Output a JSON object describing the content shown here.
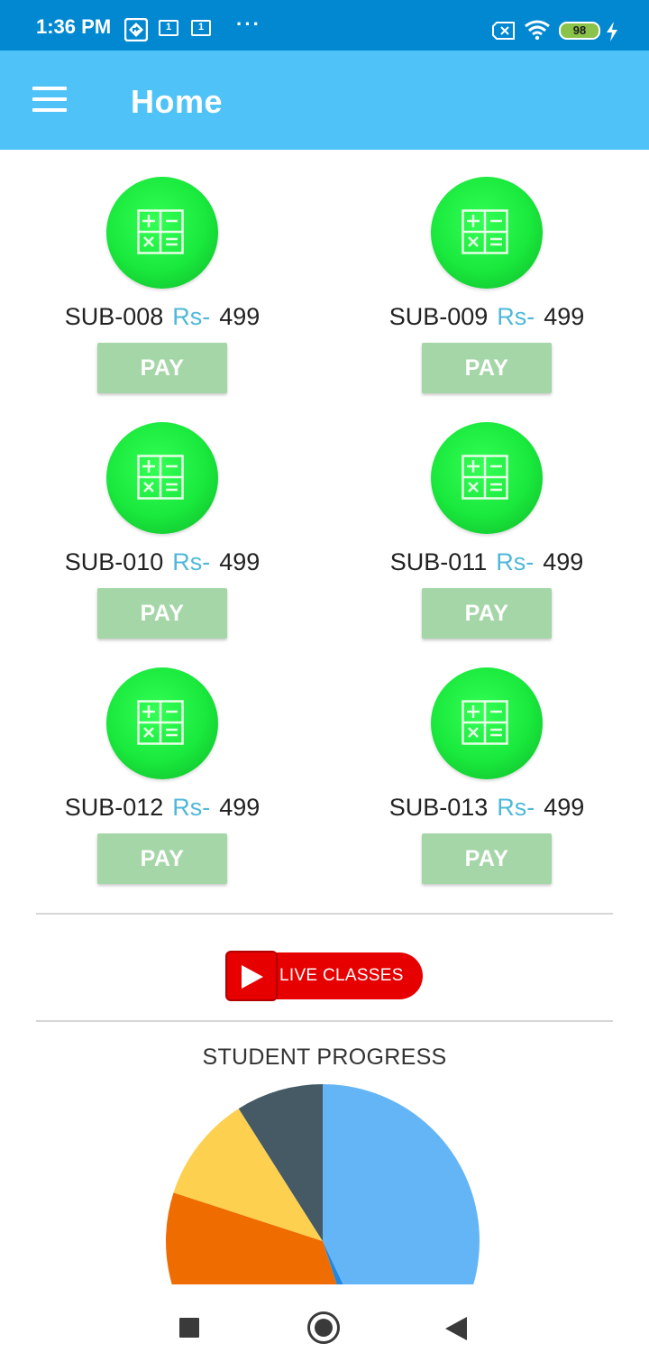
{
  "status_bar": {
    "time": "1:36 PM",
    "notif_box_1": "1",
    "notif_box_2": "1",
    "more_dots": "···",
    "battery": "98",
    "icons": [
      "maps-icon",
      "notification-box-icon",
      "notification-box-icon",
      "more-dots-icon",
      "no-sim-icon",
      "wifi-icon",
      "battery-icon",
      "charging-icon"
    ]
  },
  "app_bar": {
    "title": "Home",
    "menu_icon": "hamburger-menu-icon"
  },
  "subjects": [
    {
      "code": "SUB-008",
      "currency": "Rs-",
      "price": "499",
      "pay_label": "PAY"
    },
    {
      "code": "SUB-009",
      "currency": "Rs-",
      "price": "499",
      "pay_label": "PAY"
    },
    {
      "code": "SUB-010",
      "currency": "Rs-",
      "price": "499",
      "pay_label": "PAY"
    },
    {
      "code": "SUB-011",
      "currency": "Rs-",
      "price": "499",
      "pay_label": "PAY"
    },
    {
      "code": "SUB-012",
      "currency": "Rs-",
      "price": "499",
      "pay_label": "PAY"
    },
    {
      "code": "SUB-013",
      "currency": "Rs-",
      "price": "499",
      "pay_label": "PAY"
    }
  ],
  "subject_icon": "calculator-icon",
  "live_classes": {
    "label": "LIVE CLASSES",
    "icon": "play-icon"
  },
  "progress": {
    "title": "STUDENT PROGRESS"
  },
  "chart_data": {
    "type": "pie",
    "title": "STUDENT PROGRESS",
    "series": [
      {
        "values": [
          43,
          2,
          35,
          11,
          9
        ]
      }
    ],
    "colors": [
      "#64B5F6",
      "#1E88E5",
      "#EF6C00",
      "#FDD04F",
      "#455A64"
    ],
    "partially_visible": true
  },
  "nav_bar": {
    "icons": [
      "recents-square-icon",
      "home-circle-icon",
      "back-triangle-icon"
    ]
  },
  "colors": {
    "status_bar": "#0288D1",
    "app_bar": "#4FC3F7",
    "pay_button": "#A5D6A7",
    "accent_rs": "#4FB8D8",
    "live_red": "#E60000",
    "subject_green": "#19E83C"
  }
}
